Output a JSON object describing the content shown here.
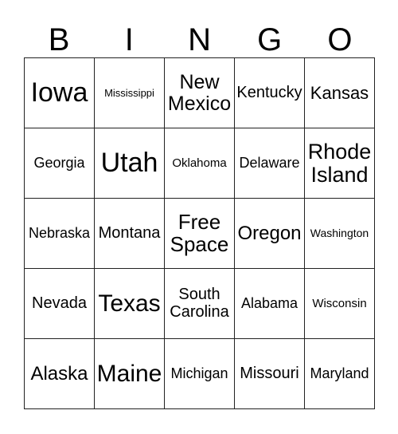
{
  "card": {
    "title": "BINGO",
    "headers": [
      "B",
      "I",
      "N",
      "G",
      "O"
    ],
    "border_color": "#222222",
    "background_color": "#ffffff",
    "text_color": "#000000",
    "columns": 5,
    "rows": 5,
    "cells": [
      {
        "text": "Iowa",
        "size": "fs-6xl"
      },
      {
        "text": "Mississippi",
        "size": "fs-xs"
      },
      {
        "text": "New\nMexico",
        "size": "fs-2xl"
      },
      {
        "text": "Kentucky",
        "size": "fs-ml"
      },
      {
        "text": "Kansas",
        "size": "fs-l"
      },
      {
        "text": "Georgia",
        "size": "fs-m"
      },
      {
        "text": "Utah",
        "size": "fs-6xl"
      },
      {
        "text": "Oklahoma",
        "size": "fs-sm"
      },
      {
        "text": "Delaware",
        "size": "fs-m"
      },
      {
        "text": "Rhode\nIsland",
        "size": "fs-4xl"
      },
      {
        "text": "Nebraska",
        "size": "fs-m"
      },
      {
        "text": "Montana",
        "size": "fs-ml"
      },
      {
        "text": "Free\nSpace",
        "size": "fs-3xl"
      },
      {
        "text": "Oregon",
        "size": "fs-xl"
      },
      {
        "text": "Washington",
        "size": "fs-s"
      },
      {
        "text": "Nevada",
        "size": "fs-ml"
      },
      {
        "text": "Texas",
        "size": "fs-5xl"
      },
      {
        "text": "South\nCarolina",
        "size": "fs-ml"
      },
      {
        "text": "Alabama",
        "size": "fs-m"
      },
      {
        "text": "Wisconsin",
        "size": "fs-sm"
      },
      {
        "text": "Alaska",
        "size": "fs-xl"
      },
      {
        "text": "Maine",
        "size": "fs-5xl"
      },
      {
        "text": "Michigan",
        "size": "fs-m"
      },
      {
        "text": "Missouri",
        "size": "fs-ml"
      },
      {
        "text": "Maryland",
        "size": "fs-m"
      }
    ]
  }
}
